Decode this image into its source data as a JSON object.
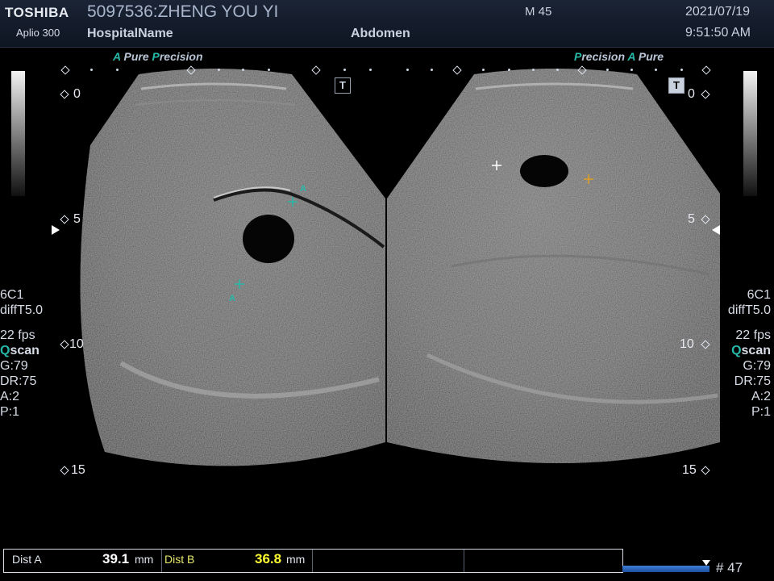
{
  "header": {
    "brand": "TOSHIBA",
    "model": "Aplio 300",
    "patient": "5097536:ZHENG YOU YI",
    "hospital": "HospitalName",
    "exam": "Abdomen",
    "mode": "M 45",
    "date": "2021/07/19",
    "time": "9:51:50 AM"
  },
  "left_image": {
    "tag_a": "A",
    "tag_pure": "Pure",
    "tag_p": "P",
    "tag_precision": "recision",
    "depth": [
      "0",
      "5",
      "10",
      "15"
    ],
    "caliper_label": "A",
    "t_icon": "T"
  },
  "right_image": {
    "tag_p": "P",
    "tag_precision": "recision",
    "tag_a": "A",
    "tag_pure": "Pure",
    "depth": [
      "0",
      "5",
      "10",
      "15"
    ],
    "t_icon": "T"
  },
  "params": {
    "probe": "6C1",
    "mode": "diffT5.0",
    "fps": "22 fps",
    "qscan_q": "Q",
    "qscan": "scan",
    "gain": "G:79",
    "dr": "DR:75",
    "a": "A:2",
    "p": "P:1"
  },
  "measurements": {
    "dist_a_label": "Dist A",
    "dist_a_int": "39.1",
    "dist_a_unit": "mm",
    "dist_b_label": "Dist B",
    "dist_b_int": "36.8",
    "dist_b_unit": "mm"
  },
  "cine": {
    "frame_label": "# 47"
  },
  "colors": {
    "accent": "#27b8a8",
    "dist_b_value": "#ffff33",
    "cine_bar": "#3d7fd6"
  }
}
